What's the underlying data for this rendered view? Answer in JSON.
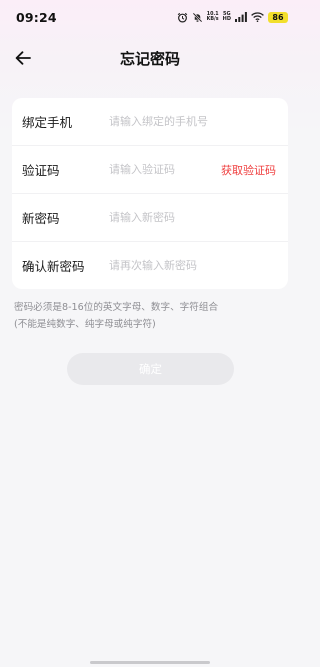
{
  "status_bar": {
    "time": "09:24",
    "net_speed_value": "10.1",
    "net_speed_unit": "KB/s",
    "network_generation": "5G",
    "network_type": "HD",
    "battery": "86"
  },
  "header": {
    "title": "忘记密码"
  },
  "form": {
    "phone": {
      "label": "绑定手机",
      "placeholder": "请输入绑定的手机号"
    },
    "code": {
      "label": "验证码",
      "placeholder": "请输入验证码",
      "action": "获取验证码"
    },
    "new_password": {
      "label": "新密码",
      "placeholder": "请输入新密码"
    },
    "confirm_password": {
      "label": "确认新密码",
      "placeholder": "请再次输入新密码"
    }
  },
  "hint": {
    "line1": "密码必须是8-16位的英文字母、数字、字符组合",
    "line2": "(不能是纯数字、纯字母或纯字符)"
  },
  "submit": {
    "label": "确定"
  },
  "colors": {
    "accent_red": "#ef3d3d",
    "battery_yellow": "#f2df2c",
    "disabled_button": "#e9e9ec"
  }
}
